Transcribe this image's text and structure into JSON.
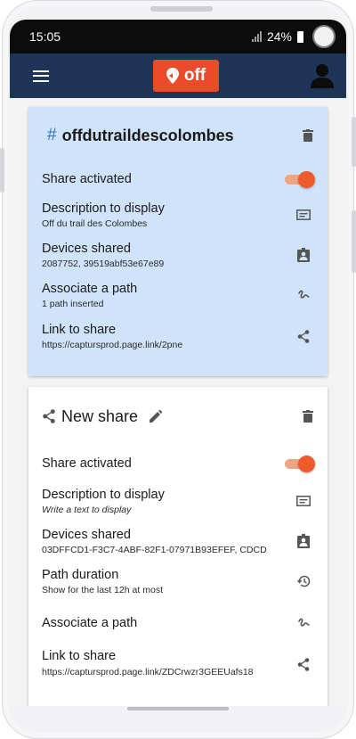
{
  "status_bar": {
    "time": "15:05",
    "battery": "24%"
  },
  "app_bar": {
    "logo_text": "off"
  },
  "colors": {
    "app_bar": "#1e3558",
    "logo": "#ea4b2b",
    "active_card": "#cfe3fb",
    "toggle": "#ee5a2c"
  },
  "cards": [
    {
      "hash": "#",
      "title": "offdutraildescolombes",
      "share_label": "Share activated",
      "description_label": "Description to display",
      "description_value": "Off du trail des Colombes",
      "devices_label": "Devices shared",
      "devices_value": "2087752, 39519abf53e67e89",
      "path_label": "Associate a path",
      "path_value": "1 path inserted",
      "link_label": "Link to share",
      "link_value": "https://captursprod.page.link/2pne"
    },
    {
      "title": "New share",
      "share_label": "Share activated",
      "description_label": "Description to display",
      "description_value": "Write a text to display",
      "devices_label": "Devices shared",
      "devices_value": "03DFFCD1-F3C7-4ABF-82F1-07971B93EFEF, CDCD",
      "duration_label": "Path duration",
      "duration_value": "Show for the last 12h at most",
      "path_label": "Associate a path",
      "link_label": "Link to share",
      "link_value": "https://captursprod.page.link/ZDCrwzr3GEEUafs18"
    }
  ]
}
